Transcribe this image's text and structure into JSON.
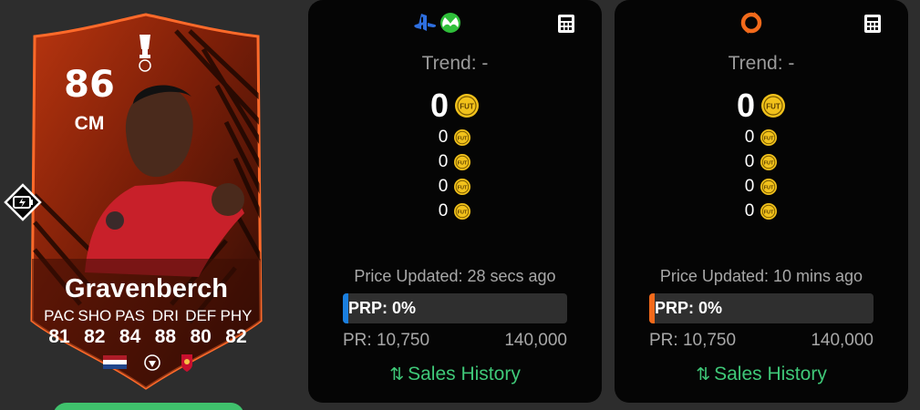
{
  "card": {
    "rating": "86",
    "position": "CM",
    "name": "Gravenberch",
    "stat_labels": [
      "PAC",
      "SHO",
      "PAS",
      "DRI",
      "DEF",
      "PHY"
    ],
    "stat_values": [
      "81",
      "82",
      "84",
      "88",
      "80",
      "82"
    ],
    "nation": "Netherlands",
    "league": "Premier League",
    "club": "Liverpool",
    "accent_color": "#ff5a1f"
  },
  "panels": [
    {
      "platform_icons": [
        "playstation-icon",
        "xbox-icon"
      ],
      "trend_label": "Trend: -",
      "main_price": "0",
      "sub_prices": [
        "0",
        "0",
        "0",
        "0"
      ],
      "updated": "Price Updated: 28 secs ago",
      "prp_label": "PRP: 0%",
      "prp_color": "#1a7fe0",
      "pr_label": "PR: 10,750",
      "pr_max": "140,000",
      "sales_label": "Sales History"
    },
    {
      "platform_icons": [
        "origin-icon"
      ],
      "trend_label": "Trend: -",
      "main_price": "0",
      "sub_prices": [
        "0",
        "0",
        "0",
        "0"
      ],
      "updated": "Price Updated: 10 mins ago",
      "prp_label": "PRP: 0%",
      "prp_color": "#f26a1b",
      "pr_label": "PR: 10,750",
      "pr_max": "140,000",
      "sales_label": "Sales History"
    }
  ],
  "coin_label": "FUT",
  "colors": {
    "coin": "#f2c21b",
    "sales_green": "#3fc878",
    "panel_bg": "#050505",
    "page_bg": "#2d2d2d"
  }
}
